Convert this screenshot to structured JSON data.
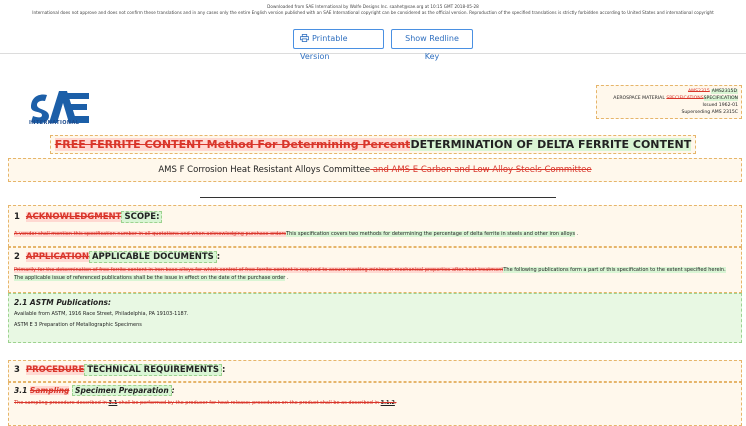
{
  "banner": {
    "download_line": "Downloaded from SAE International by Wolfe Designs Inc. saahet@sae.org at 10:15 GMT 2018-05-28",
    "copyright_line": "International does not approve and does not confirm these translations and in any cases only the entire English version published with an SAE International copyright can be considered as the official version. Reproduction of the specified translations is strictly forbidden according to United States and international copyright",
    "printable_label": "Printable Version",
    "redline_label": "Show Redline Key"
  },
  "logo": {
    "text": "INTERNATIONAL"
  },
  "info": {
    "ams_del": "AMS2315",
    "ams_ins": "AMS2315D",
    "material_label": "AEROSPACE MATERIAL",
    "spec_del": "SPECIFICATIONS",
    "spec_ins": "SPECIFICATION",
    "issued": "Issued 1962-01",
    "superseding": "Superseding AMS 2315C"
  },
  "title": {
    "deleted": "FREE FERRITE CONTENT Method For Determining Percent",
    "inserted": "DETERMINATION OF DELTA FERRITE CONTENT"
  },
  "committee": {
    "kept": "AMS F Corrosion Heat Resistant Alloys Committee",
    "deleted": " and  AMS E Carbon and Low Alloy Steels Committee"
  },
  "section1": {
    "num": "1",
    "title_del": "ACKNOWLEDGMENT",
    "title_ins": "SCOPE",
    "body_del": "A vendor shall mention this specification number in all quotations and when acknowledging purchase orders",
    "body_ins": "This specification covers two methods for determining the percentage of delta ferrite in steels and other iron alloys"
  },
  "section2": {
    "num": "2",
    "title_del": "APPLICATION",
    "title_ins": "APPLICABLE DOCUMENTS",
    "body_del": "Primarily for the determination of free ferrite content in iron base alloys for which control of free ferrite content is required to assure meeting minimum mechanical properties after heat treatment",
    "body_ins": "The following publications form a part of this specification to the extent specified herein. The applicable issue of referenced publications shall be the issue in effect on the date of the purchase order"
  },
  "section21": {
    "num": "2.1",
    "title": "ASTM Publications:",
    "line1": "Available from ASTM, 1916 Race Street, Philadelphia, PA 19103-1187.",
    "line2": "ASTM E 3 Preparation of Metallographic Specimens"
  },
  "section3": {
    "num": "3",
    "title_del": "PROCEDURE",
    "title_ins": "TECHNICAL REQUIREMENTS"
  },
  "section31": {
    "num": "3.1",
    "title_del": "Sampling",
    "title_ins": "Specimen Preparation",
    "body_a": "The sampling procedure described in ",
    "ref1": "3.1",
    "body_b": " shall be performed by the producer for heat release; procedures on the product shall be as described in ",
    "ref2": "3.1.2",
    "body_c": "."
  }
}
